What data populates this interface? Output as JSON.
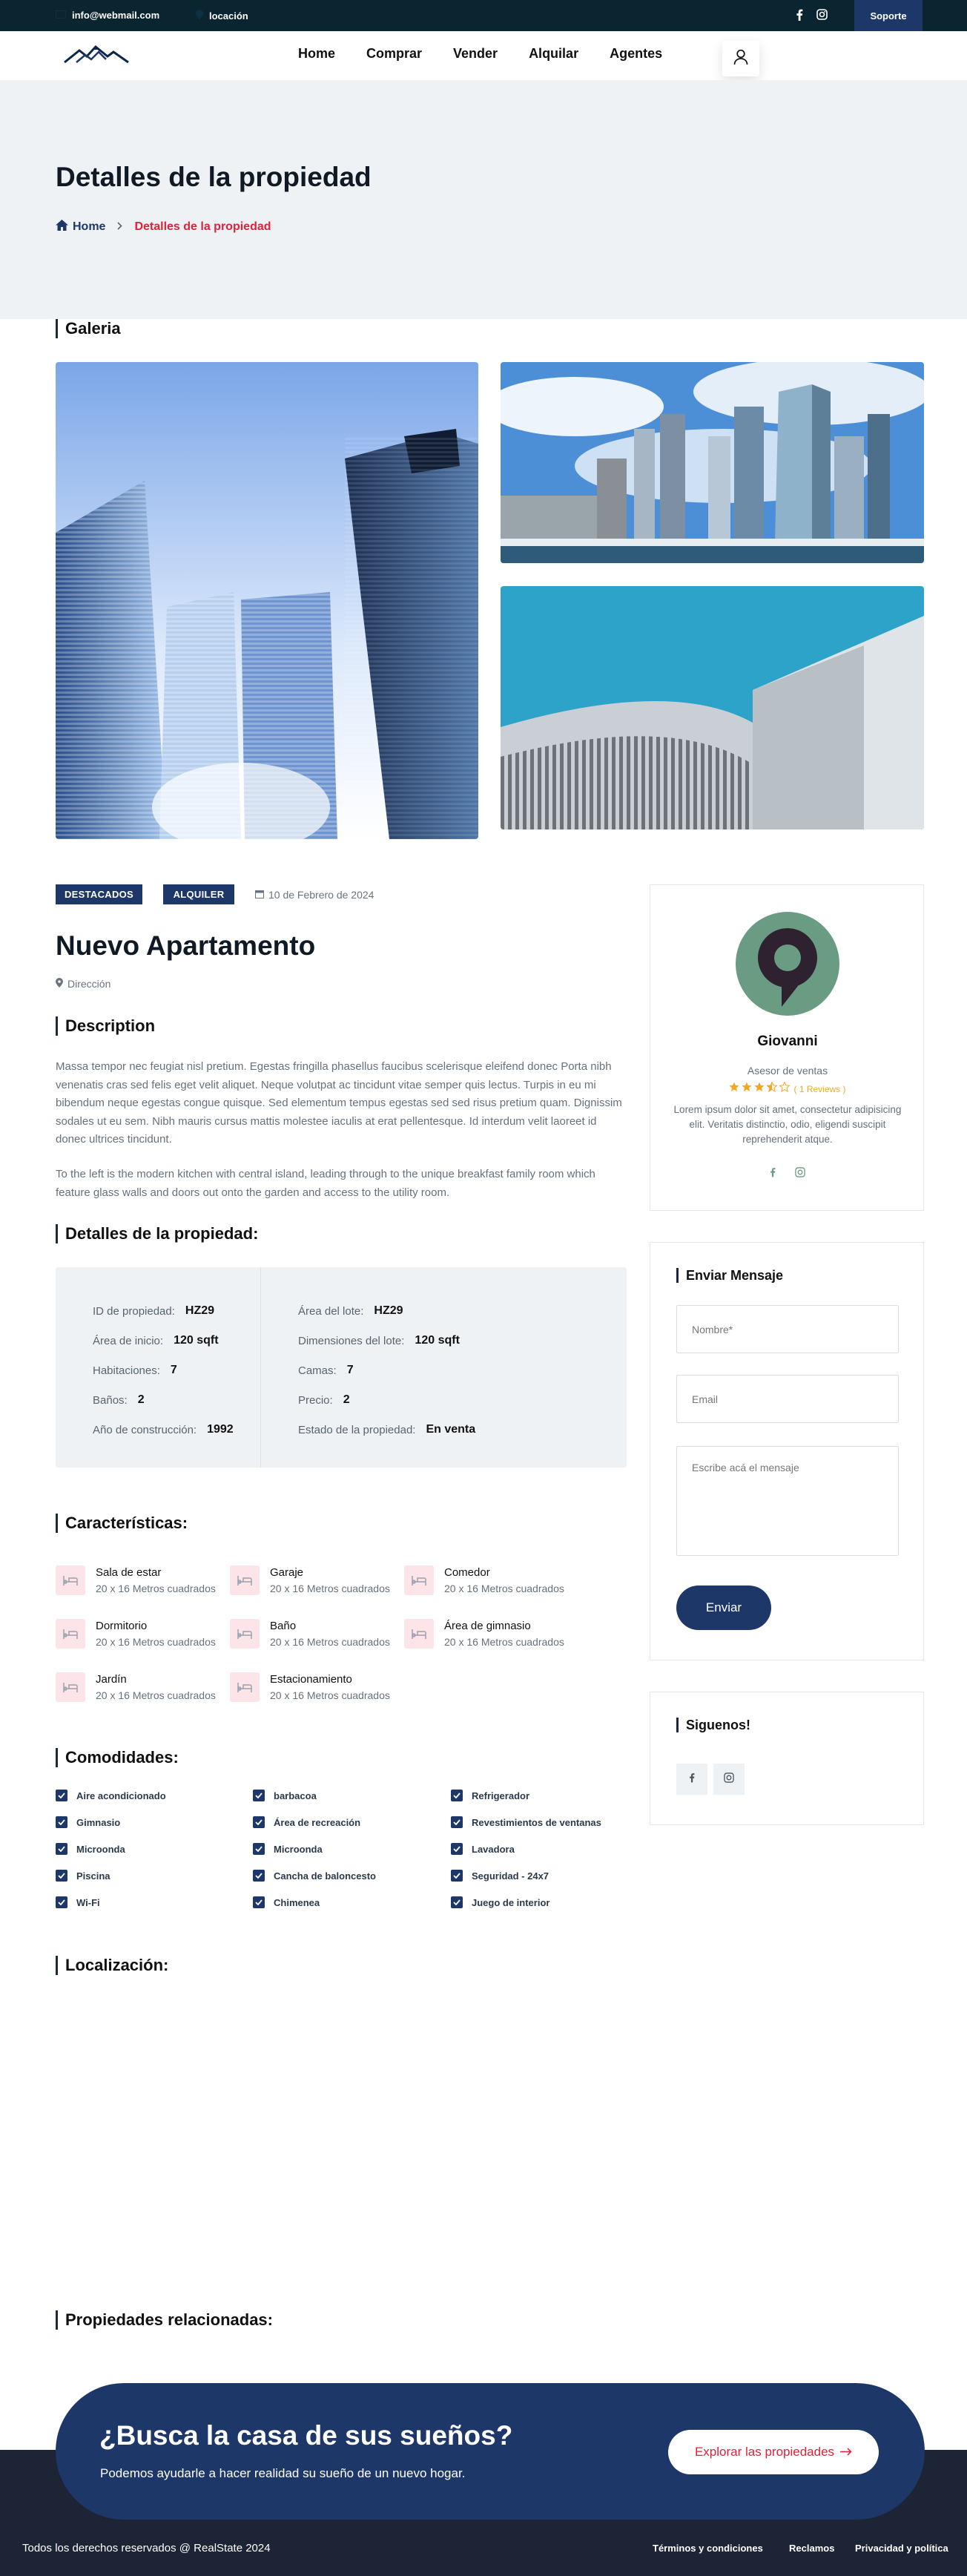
{
  "topbar": {
    "email": "info@webmail.com",
    "location": "locación",
    "support_label": "Soporte"
  },
  "nav": {
    "items": [
      "Home",
      "Comprar",
      "Vender",
      "Alquilar",
      "Agentes"
    ]
  },
  "hero": {
    "title": "Detalles de la propiedad",
    "breadcrumb_home": "Home",
    "breadcrumb_current": "Detalles de la propiedad"
  },
  "gallery": {
    "title": "Galeria"
  },
  "listing": {
    "tag_featured": "DESTACADOS",
    "tag_rent": "ALQUILER",
    "date": "10 de Febrero de 2024",
    "title": "Nuevo Apartamento",
    "address": "Dirección",
    "description_title": "Description",
    "description_p1": "Massa tempor nec feugiat nisl pretium. Egestas fringilla phasellus faucibus scelerisque eleifend donec Porta nibh venenatis cras sed felis eget velit aliquet. Neque volutpat ac tincidunt vitae semper quis lectus. Turpis in eu mi bibendum neque egestas congue quisque. Sed elementum tempus egestas sed sed risus pretium quam. Dignissim sodales ut eu sem. Nibh mauris cursus mattis molestee iaculis at erat pellentesque. Id interdum velit laoreet id donec ultrices tincidunt.",
    "description_p2": "To the left is the modern kitchen with central island, leading through to the unique breakfast family room which feature glass walls and doors out onto the garden and access to the utility room."
  },
  "details": {
    "title": "Detalles de la propiedad:",
    "left": [
      {
        "k": "ID de propiedad:",
        "v": "HZ29"
      },
      {
        "k": "Área de inicio:",
        "v": "120 sqft"
      },
      {
        "k": "Habitaciones:",
        "v": "7"
      },
      {
        "k": "Baños:",
        "v": "2"
      },
      {
        "k": "Año de construcción:",
        "v": "1992"
      }
    ],
    "right": [
      {
        "k": "Área del lote:",
        "v": "HZ29"
      },
      {
        "k": "Dimensiones del lote:",
        "v": "120 sqft"
      },
      {
        "k": "Camas:",
        "v": "7"
      },
      {
        "k": "Precio:",
        "v": "2"
      },
      {
        "k": "Estado de la propiedad:",
        "v": "En venta"
      }
    ]
  },
  "features": {
    "title": "Características:",
    "items": [
      {
        "name": "Sala de estar",
        "size": "20 x 16 Metros cuadrados"
      },
      {
        "name": "Garaje",
        "size": "20 x 16 Metros cuadrados"
      },
      {
        "name": "Comedor",
        "size": "20 x 16 Metros cuadrados"
      },
      {
        "name": "Dormitorio",
        "size": "20 x 16 Metros cuadrados"
      },
      {
        "name": "Baño",
        "size": "20 x 16 Metros cuadrados"
      },
      {
        "name": "Área de gimnasio",
        "size": "20 x 16 Metros cuadrados"
      },
      {
        "name": "Jardín",
        "size": "20 x 16 Metros cuadrados"
      },
      {
        "name": "Estacionamiento",
        "size": "20 x 16 Metros cuadrados"
      }
    ]
  },
  "amenities": {
    "title": "Comodidades:",
    "items": [
      "Aire acondicionado",
      "barbacoa",
      "Refrigerador",
      "Gimnasio",
      "Área de recreación",
      "Revestimientos de ventanas",
      "Microonda",
      "Microonda",
      "Lavadora",
      "Piscina",
      "Cancha de baloncesto",
      "Seguridad - 24x7",
      "Wi-Fi",
      "Chimenea",
      "Juego de interior"
    ]
  },
  "location": {
    "title": "Localización:"
  },
  "related": {
    "title": "Propiedades relacionadas:"
  },
  "agent": {
    "name": "Giovanni",
    "role": "Asesor de ventas",
    "reviews": "( 1 Reviews )",
    "rating": 3.5,
    "bio": "Lorem ipsum dolor sit amet, consectetur adipisicing elit. Veritatis distinctio, odio, eligendi suscipit reprehenderit atque.",
    "avatar_color": "#6a9c84"
  },
  "contact": {
    "title": "Enviar Mensaje",
    "name_placeholder": "Nombre*",
    "email_placeholder": "Email",
    "message_placeholder": "Escribe acá el mensaje",
    "submit_label": "Enviar"
  },
  "follow": {
    "title": "Siguenos!"
  },
  "cta": {
    "title": "¿Busca la casa de sus sueños?",
    "subtitle": "Podemos ayudarle a hacer realidad su sueño de un nuevo hogar.",
    "button_label": "Explorar las propiedades"
  },
  "footer": {
    "copyright": "Todos los derechos reservados @ RealState 2024",
    "links": [
      "Términos y condiciones",
      "Reclamos",
      "Privacidad y política"
    ]
  },
  "colors": {
    "brand_navy": "#1d3768",
    "accent_red": "#e0213a",
    "topbar_bg": "#0a2430",
    "star": "#f5a623"
  },
  "icons": [
    "envelope-icon",
    "map-pin-icon",
    "facebook-icon",
    "instagram-icon",
    "user-icon",
    "home-icon",
    "calendar-icon",
    "bed-icon",
    "check-icon",
    "arrow-right-icon"
  ]
}
